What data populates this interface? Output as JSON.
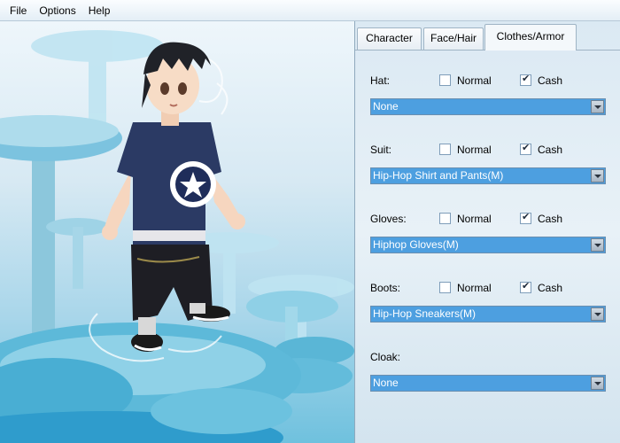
{
  "menu": {
    "file": "File",
    "options": "Options",
    "help": "Help"
  },
  "tabs": [
    "Character",
    "Face/Hair",
    "Clothes/Armor"
  ],
  "active_tab": "Clothes/Armor",
  "options": {
    "normal": "Normal",
    "cash": "Cash"
  },
  "slots": {
    "hat": {
      "label": "Hat:",
      "normal": false,
      "cash": true,
      "value": "None"
    },
    "suit": {
      "label": "Suit:",
      "normal": false,
      "cash": true,
      "value": "Hip-Hop Shirt and Pants(M)"
    },
    "gloves": {
      "label": "Gloves:",
      "normal": false,
      "cash": true,
      "value": "Hiphop Gloves(M)"
    },
    "boots": {
      "label": "Boots:",
      "normal": false,
      "cash": true,
      "value": "Hip-Hop Sneakers(M)"
    },
    "cloak": {
      "label": "Cloak:",
      "value": "None"
    }
  },
  "colors": {
    "dropdown_bg": "#4d9fe0",
    "panel_bg": "#dbe9f3"
  },
  "icons": {
    "dropdown": "chevron-down-icon",
    "shirt_logo": "star-logo-icon"
  }
}
